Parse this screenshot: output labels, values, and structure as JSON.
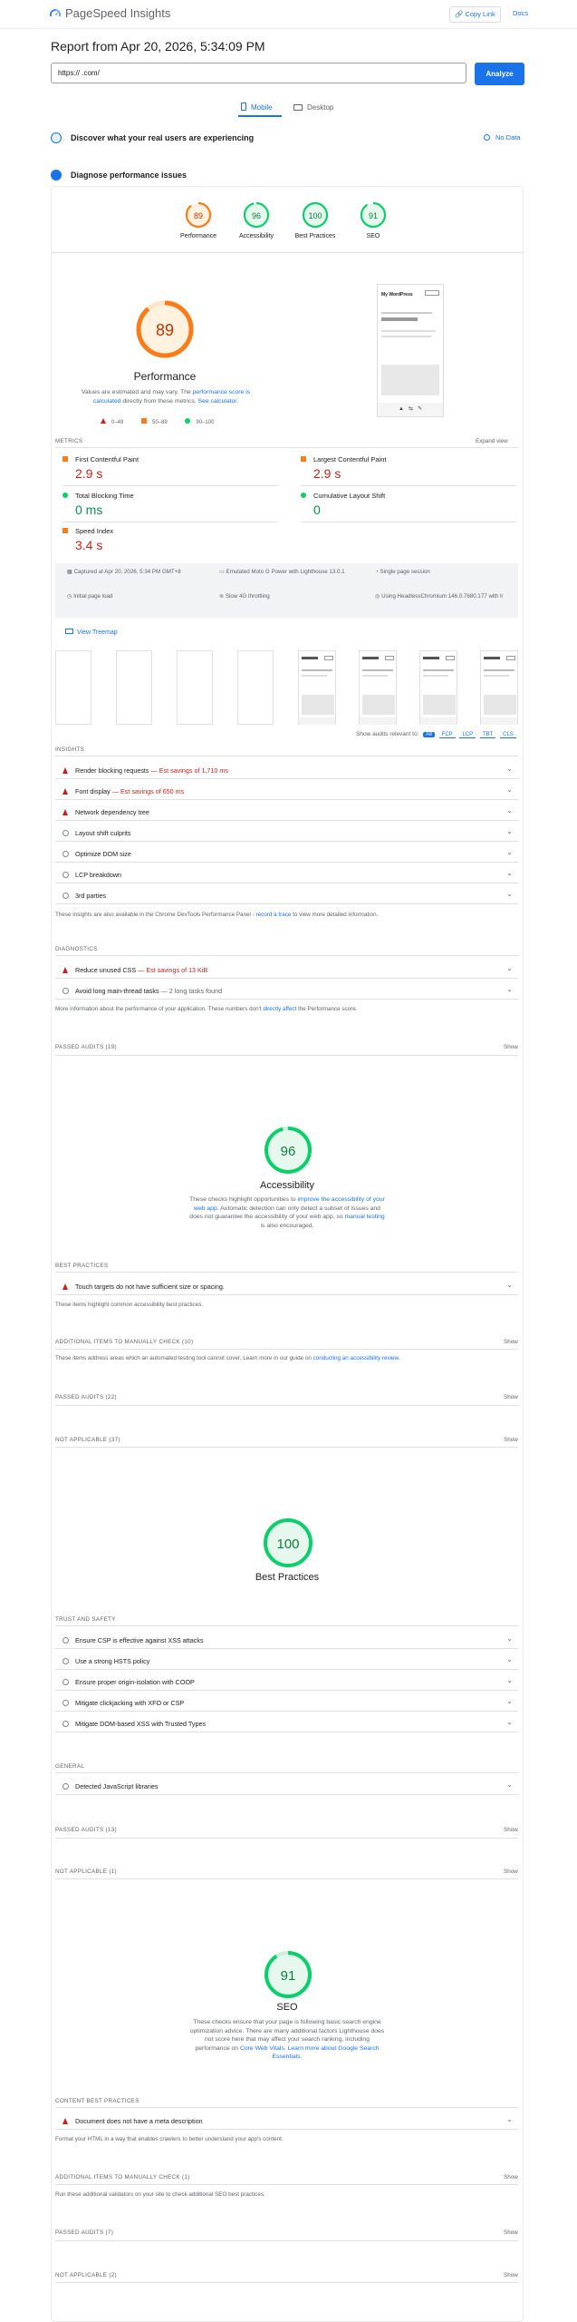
{
  "header": {
    "brand": "PageSpeed Insights",
    "copy_link": "Copy Link",
    "docs": "Docs"
  },
  "report": {
    "title": "Report from Apr 20, 2026, 5:34:09 PM",
    "url_value": "https://                    .com/",
    "analyze": "Analyze"
  },
  "devices": {
    "mobile": "Mobile",
    "desktop": "Desktop"
  },
  "sections": {
    "real_users": "Discover what your real users are experiencing",
    "no_data": "No Data",
    "diagnose": "Diagnose performance issues"
  },
  "gauges": [
    {
      "label": "Performance",
      "value": "89",
      "score": 89,
      "color": "#fa7b17"
    },
    {
      "label": "Accessibility",
      "value": "96",
      "score": 96,
      "color": "#0cce6b"
    },
    {
      "label": "Best Practices",
      "value": "100",
      "score": 100,
      "color": "#0cce6b"
    },
    {
      "label": "SEO",
      "value": "91",
      "score": 91,
      "color": "#0cce6b"
    }
  ],
  "performance": {
    "score": "89",
    "title": "Performance",
    "desc1": "Values are estimated and may vary. The ",
    "desc_link1": "performance score is calculated",
    "desc2": " directly from these metrics. ",
    "desc_link2": "See calculator.",
    "legend": [
      "0–49",
      "50–89",
      "90–100"
    ]
  },
  "metrics": {
    "label": "METRICS",
    "expand": "Expand view",
    "items": [
      {
        "name": "First Contentful Paint",
        "value": "2.9 s",
        "color": "#c5221f",
        "shape": "square"
      },
      {
        "name": "Largest Contentful Paint",
        "value": "2.9 s",
        "color": "#c5221f",
        "shape": "square"
      },
      {
        "name": "Total Blocking Time",
        "value": "0 ms",
        "color": "#0d904f",
        "shape": "circle"
      },
      {
        "name": "Cumulative Layout Shift",
        "value": "0",
        "color": "#0d904f",
        "shape": "circle"
      },
      {
        "name": "Speed Index",
        "value": "3.4 s",
        "color": "#c5221f",
        "shape": "square"
      }
    ]
  },
  "env": {
    "captured": "Captured at Apr 20, 2026, 5:34 PM GMT+8",
    "device": "Emulated Moto G Power with Lighthouse 13.0.1",
    "session": "Single page session",
    "initial": "Initial page load",
    "throttle": "Slow 4G throttling",
    "browser": "Using HeadlessChromium 146.0.7680.177 with lr"
  },
  "treemap": "View Treemap",
  "screenshot_site": "My WordPress",
  "filter": {
    "label": "Show audits relevant to:",
    "options": [
      "All",
      "FCP",
      "LCP",
      "TBT",
      "CLS"
    ]
  },
  "insights": {
    "label": "INSIGHTS",
    "items": [
      {
        "title": "Render blocking requests",
        "savings": "— Est savings of 1,710 ms",
        "icon": "fail"
      },
      {
        "title": "Font display",
        "savings": "— Est savings of 650 ms",
        "icon": "fail"
      },
      {
        "title": "Network dependency tree",
        "savings": "",
        "icon": "fail"
      },
      {
        "title": "Layout shift culprits",
        "savings": "",
        "icon": "info"
      },
      {
        "title": "Optimize DOM size",
        "savings": "",
        "icon": "info"
      },
      {
        "title": "LCP breakdown",
        "savings": "",
        "icon": "info"
      },
      {
        "title": "3rd parties",
        "savings": "",
        "icon": "info"
      }
    ],
    "note1": "These insights are also available in the Chrome DevTools Performance Panel - ",
    "note_link": "record a trace",
    "note2": " to view more detailed information."
  },
  "diagnostics": {
    "label": "DIAGNOSTICS",
    "items": [
      {
        "title": "Reduce unused CSS",
        "savings": "— Est savings of 13 KiB",
        "icon": "fail"
      },
      {
        "title": "Avoid long main-thread tasks",
        "savings": "— 2 long tasks found",
        "icon": "info"
      }
    ],
    "note1": "More information about the performance of your application. These numbers don't ",
    "note_link": "directly affect",
    "note2": " the Performance score."
  },
  "passed1": "PASSED AUDITS (19)",
  "show": "Show",
  "accessibility": {
    "score": "96",
    "title": "Accessibility",
    "desc1": "These checks highlight opportunities to ",
    "desc_link1": "improve the accessibility of your web app",
    "desc2": ". Automatic detection can only detect a subset of issues and does not guarantee the accessibility of your web app, so ",
    "desc_link2": "manual testing",
    "desc3": " is also encouraged.",
    "bp_label": "BEST PRACTICES",
    "bp_item": "Touch targets do not have sufficient size or spacing.",
    "bp_note": "These items highlight common accessibility best practices.",
    "manual": "ADDITIONAL ITEMS TO MANUALLY CHECK (10)",
    "manual_note1": "These items address areas which an automated testing tool cannot cover. Learn more in our guide on ",
    "manual_link": "conducting an accessibility review",
    "manual_note2": ".",
    "passed": "PASSED AUDITS (22)",
    "na": "NOT APPLICABLE (37)"
  },
  "bestpractices": {
    "score": "100",
    "title": "Best Practices",
    "trust_label": "TRUST AND SAFETY",
    "trust_items": [
      "Ensure CSP is effective against XSS attacks",
      "Use a strong HSTS policy",
      "Ensure proper origin-isolation with COOP",
      "Mitigate clickjacking with XFO or CSP",
      "Mitigate DOM-based XSS with Trusted Types"
    ],
    "general_label": "GENERAL",
    "general_item": "Detected JavaScript libraries",
    "passed": "PASSED AUDITS (13)",
    "na": "NOT APPLICABLE (1)"
  },
  "seo": {
    "score": "91",
    "title": "SEO",
    "desc1": "These checks ensure that your page is following basic search engine optimization advice. There are many additional factors Lighthouse does not score here that may affect your search ranking, including performance on ",
    "desc_link1": "Core Web Vitals",
    "desc2": ". ",
    "desc_link2": "Learn more about Google Search Essentials",
    "desc3": ".",
    "cbp_label": "CONTENT BEST PRACTICES",
    "cbp_item": "Document does not have a meta description",
    "cbp_note": "Format your HTML in a way that enables crawlers to better understand your app's content.",
    "manual": "ADDITIONAL ITEMS TO MANUALLY CHECK (1)",
    "manual_note": "Run these additional validators on your site to check additional SEO best practices.",
    "passed": "PASSED AUDITS (7)",
    "na": "NOT APPLICABLE (2)"
  }
}
